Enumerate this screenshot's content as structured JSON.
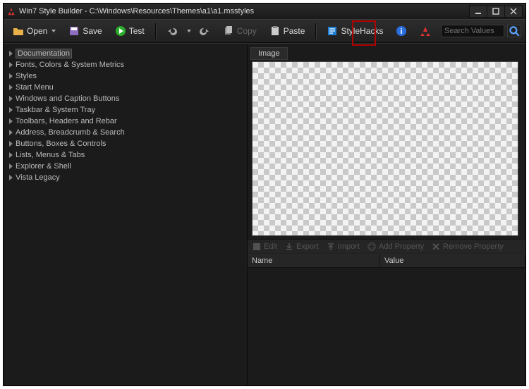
{
  "window": {
    "title": "Win7 Style Builder - C:\\Windows\\Resources\\Themes\\a1\\a1.msstyles"
  },
  "toolbar": {
    "open": "Open",
    "save": "Save",
    "test": "Test",
    "copy": "Copy",
    "paste": "Paste",
    "stylehacks": "StyleHacks"
  },
  "search": {
    "placeholder": "Search Values"
  },
  "tree": {
    "items": [
      {
        "label": "Documentation",
        "selected": true
      },
      {
        "label": "Fonts, Colors & System Metrics"
      },
      {
        "label": "Styles"
      },
      {
        "label": "Start Menu"
      },
      {
        "label": "Windows and Caption Buttons"
      },
      {
        "label": "Taskbar & System Tray"
      },
      {
        "label": "Toolbars, Headers and Rebar"
      },
      {
        "label": "Address, Breadcrumb & Search"
      },
      {
        "label": "Buttons, Boxes & Controls"
      },
      {
        "label": "Lists, Menus & Tabs"
      },
      {
        "label": "Explorer & Shell"
      },
      {
        "label": "Vista Legacy"
      }
    ]
  },
  "image_tab": "Image",
  "prop_toolbar": {
    "edit": "Edit",
    "export": "Export",
    "import": "Import",
    "add": "Add Property",
    "remove": "Remove Property"
  },
  "prop_columns": {
    "name": "Name",
    "value": "Value"
  }
}
